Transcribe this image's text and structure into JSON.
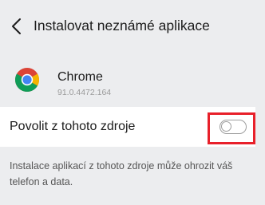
{
  "header": {
    "title": "Instalovat neznámé aplikace",
    "back_icon": "chevron-left-icon"
  },
  "app": {
    "name": "Chrome",
    "version": "91.0.4472.164",
    "icon": "chrome-icon"
  },
  "setting": {
    "label": "Povolit z tohoto zdroje",
    "enabled": false
  },
  "warning": {
    "text": "Instalace aplikací z tohoto zdroje může ohrozit váš telefon a data."
  },
  "colors": {
    "background": "#ecedef",
    "highlight": "#e8202a",
    "toggle_border": "#9e9e9e"
  }
}
